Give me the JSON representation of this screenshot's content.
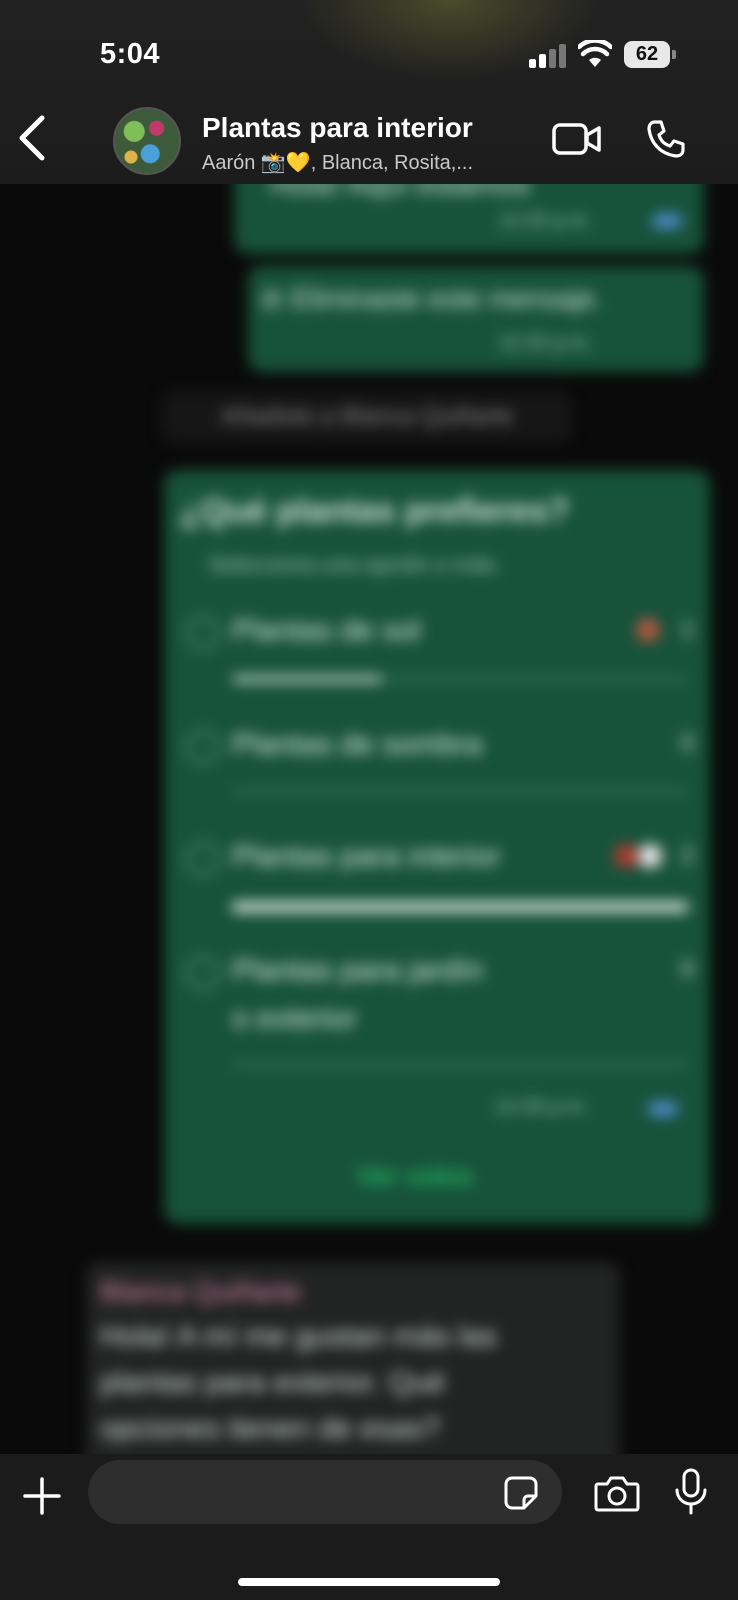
{
  "status_bar": {
    "time": "5:04",
    "battery": "62"
  },
  "header": {
    "title": "Plantas para interior",
    "subtitle": "Aarón  📸💛, Blanca, Rosita,..."
  },
  "colors": {
    "outgoing_bubble": "#17523b",
    "incoming_bubble": "#222323",
    "background": "#0b0b0b",
    "header": "#1c1c1c",
    "sender_name": "#d98aa8",
    "accent_green": "#25d366",
    "tick_blue": "#4f8ed0"
  },
  "chat": {
    "msg1": {
      "text": "Hola! Aquí estamos",
      "time": "12:25 p.m."
    },
    "msg2": {
      "text": "⊘ Eliminaste este mensaje.",
      "time": "12:25 p.m."
    },
    "system_note": "Añadiste a Blanca Quiñarte",
    "poll": {
      "question": "¿Qué plantas prefieres?",
      "hint": "Selecciona una opción o más.",
      "options": [
        {
          "label": "Plantas de sol",
          "count": "1",
          "fill": 0.33
        },
        {
          "label": "Plantas de sombra",
          "count": "0",
          "fill": 0
        },
        {
          "label": "Plantas para interior",
          "count": "2",
          "fill": 1.0
        },
        {
          "label": "Plantas para jardín",
          "label2": "o exterior",
          "count": "0",
          "fill": 0
        }
      ],
      "time": "12:26 p.m.",
      "view_votes": "Ver votos"
    },
    "incoming": {
      "sender": "Blanca Quiñarte",
      "lines": [
        "Hola! A mí me gustan más las",
        "plantas para exterior. Qué",
        "opciones tienen de esas?"
      ]
    }
  },
  "composer": {
    "placeholder": ""
  }
}
